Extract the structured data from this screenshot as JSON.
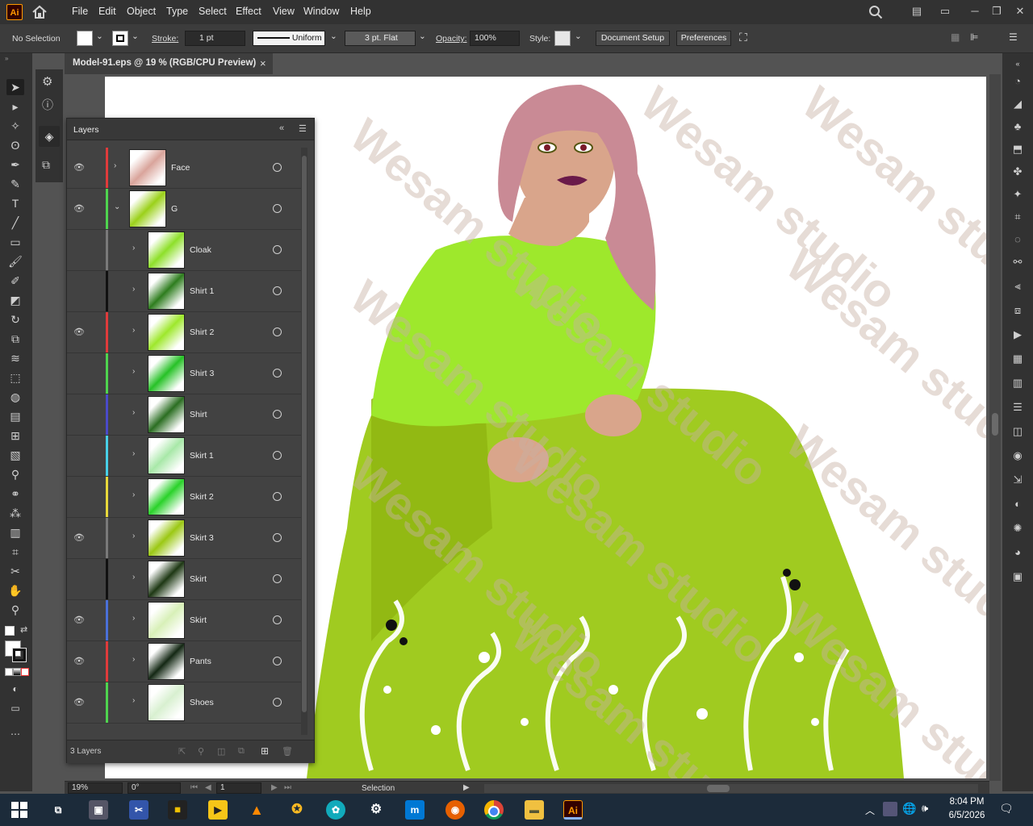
{
  "app": {
    "logo_text": "Ai"
  },
  "menu": [
    "File",
    "Edit",
    "Object",
    "Type",
    "Select",
    "Effect",
    "View",
    "Window",
    "Help"
  ],
  "control_bar": {
    "selection": "No Selection",
    "stroke_label": "Stroke:",
    "stroke_value": "1 pt",
    "profile": "Uniform",
    "brush": "3 pt. Flat",
    "opacity_label": "Opacity:",
    "opacity_value": "100%",
    "style_label": "Style:",
    "document_setup": "Document Setup",
    "preferences": "Preferences"
  },
  "document": {
    "tab_title": "Model-91.eps @ 19 % (RGB/CPU Preview)",
    "close": "×"
  },
  "layers_panel": {
    "title": "Layers",
    "footer_count": "3 Layers",
    "rows": [
      {
        "name": "Face",
        "color": "#e03b3b",
        "visible": true,
        "indent": 0,
        "expanded": false,
        "thumb": "#d9a49b"
      },
      {
        "name": "G",
        "color": "#4fd44f",
        "visible": true,
        "indent": 0,
        "expanded": true,
        "thumb": "#9bd11a"
      },
      {
        "name": "Cloak",
        "color": "#7a7a7a",
        "visible": false,
        "indent": 1,
        "expanded": false,
        "thumb": "#8ee02a"
      },
      {
        "name": "Shirt 1",
        "color": "#111111",
        "visible": false,
        "indent": 1,
        "expanded": false,
        "thumb": "#2e7d1e"
      },
      {
        "name": "Shirt 2",
        "color": "#e03b3b",
        "visible": true,
        "indent": 1,
        "expanded": false,
        "thumb": "#9ee82c"
      },
      {
        "name": "Shirt 3",
        "color": "#4fd44f",
        "visible": false,
        "indent": 1,
        "expanded": false,
        "thumb": "#27c227"
      },
      {
        "name": "Shirt",
        "color": "#4a4ac8",
        "visible": false,
        "indent": 1,
        "expanded": false,
        "thumb": "#2b6e22"
      },
      {
        "name": "Skirt 1",
        "color": "#48d0e8",
        "visible": false,
        "indent": 1,
        "expanded": false,
        "thumb": "#a8e8a8"
      },
      {
        "name": "Skirt 2",
        "color": "#e8d83b",
        "visible": false,
        "indent": 1,
        "expanded": false,
        "thumb": "#2ad22a"
      },
      {
        "name": "Skirt 3",
        "color": "#7a7a7a",
        "visible": true,
        "indent": 1,
        "expanded": false,
        "thumb": "#9bc814"
      },
      {
        "name": "Skirt",
        "color": "#111111",
        "visible": false,
        "indent": 1,
        "expanded": false,
        "thumb": "#1e3814"
      },
      {
        "name": "Skirt",
        "color": "#4a70d8",
        "visible": true,
        "indent": 1,
        "expanded": false,
        "thumb": "#d8f0b8"
      },
      {
        "name": "Pants",
        "color": "#e03b3b",
        "visible": true,
        "indent": 1,
        "expanded": false,
        "thumb": "#142814"
      },
      {
        "name": "Shoes",
        "color": "#4fd44f",
        "visible": true,
        "indent": 1,
        "expanded": false,
        "thumb": "#d8f0d0"
      }
    ]
  },
  "status_bar": {
    "zoom": "19%",
    "rotate": "0°",
    "artboard": "1",
    "tool": "Selection"
  },
  "watermark": "Wesam studio",
  "taskbar": {
    "time": "8:04 PM",
    "date": "6/5/2026",
    "apps": [
      "task-view",
      "photos",
      "snip",
      "studio",
      "player",
      "vlc",
      "game",
      "sync",
      "vscode-like",
      "firefox",
      "chrome",
      "explorer",
      "illustrator"
    ]
  }
}
